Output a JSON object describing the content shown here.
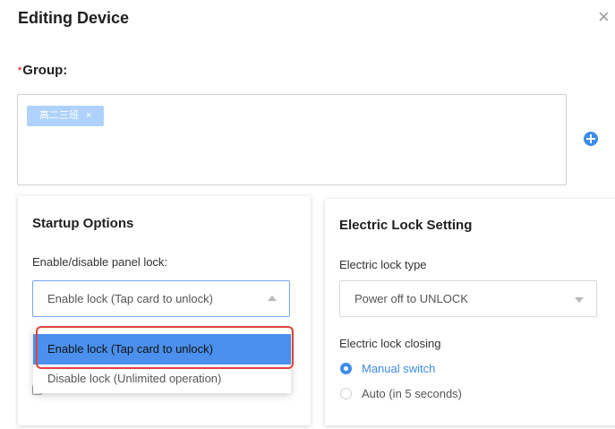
{
  "dialog": {
    "title": "Editing Device",
    "close_icon": "close-icon",
    "close_glyph": "×"
  },
  "group": {
    "required_mark": "*",
    "label": "Group:",
    "tags": [
      {
        "label": "高二三班",
        "remove_glyph": "×"
      }
    ],
    "add_icon": "plus-circle-icon"
  },
  "startup": {
    "title": "Startup Options",
    "panel_lock_label": "Enable/disable panel lock:",
    "panel_lock_value": "Enable lock (Tap card to unlock)",
    "options": [
      "Enable lock (Tap card to unlock)",
      "Disable lock (Unlimited operation)"
    ],
    "selected_index": 0
  },
  "electric_lock": {
    "title": "Electric Lock Setting",
    "type_label": "Electric lock type",
    "type_value": "Power off to UNLOCK",
    "closing_label": "Electric lock closing",
    "closing_options": [
      {
        "label": "Manual switch",
        "selected": true
      },
      {
        "label": "Auto (in 5 seconds)",
        "selected": false
      }
    ]
  },
  "colors": {
    "accent": "#3d8ce8",
    "highlight_border": "#e0443e",
    "tag_bg": "#aed2fb",
    "selected_option_bg": "#4a90ec"
  }
}
